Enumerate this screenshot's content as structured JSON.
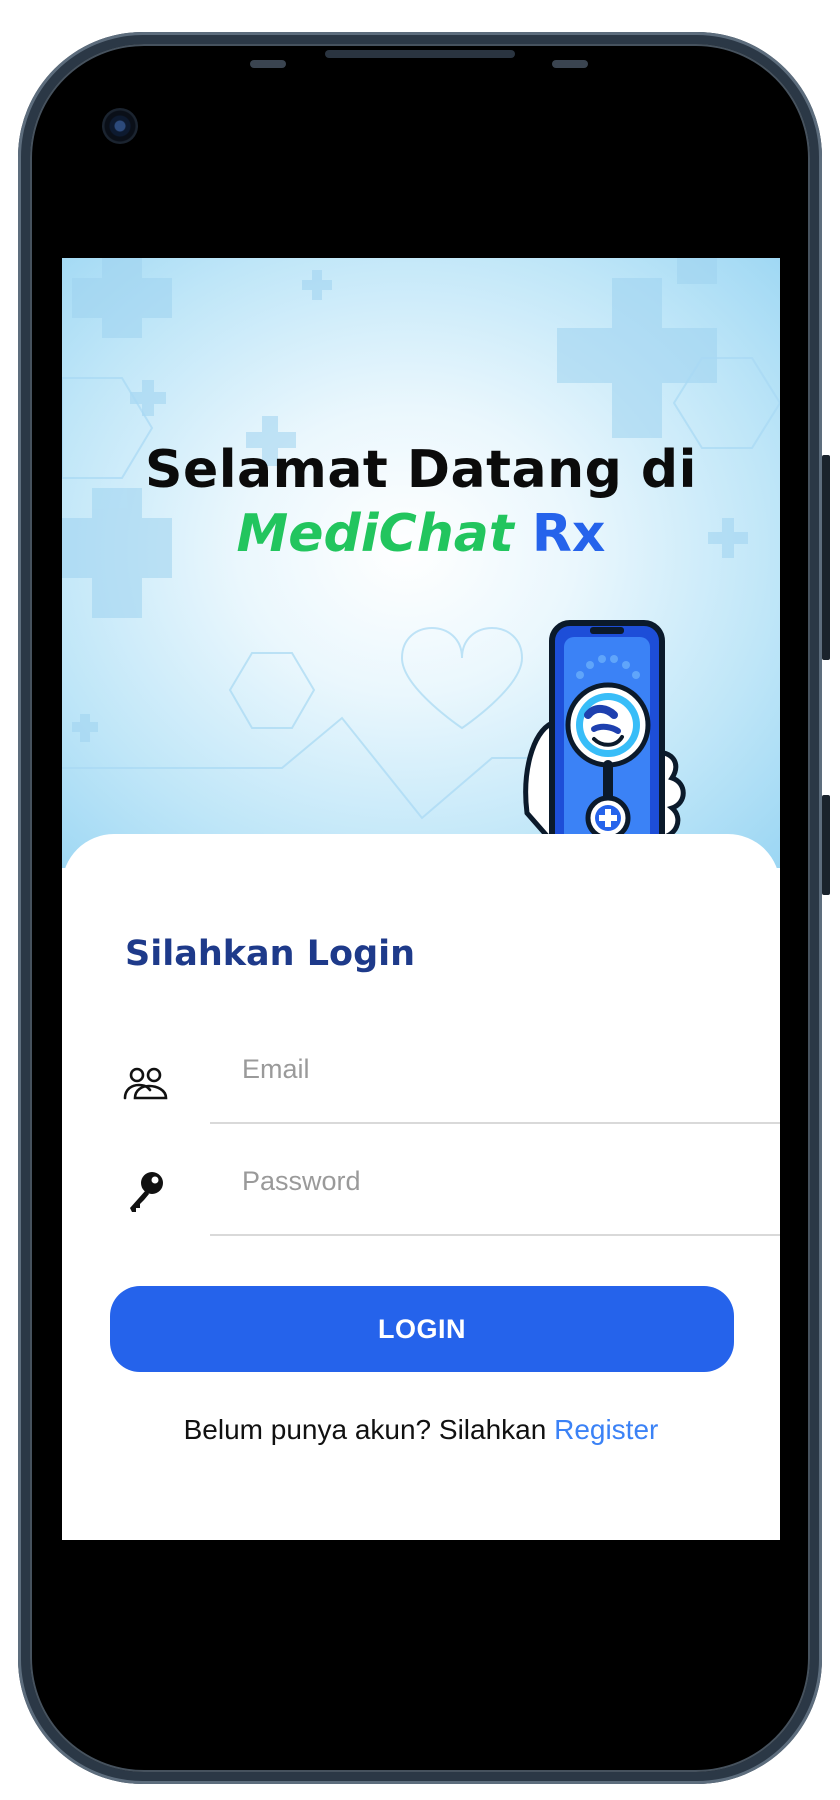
{
  "welcome": {
    "line1": "Selamat Datang di",
    "brand_green": "MediChat",
    "brand_blue": "Rx"
  },
  "login": {
    "title": "Silahkan Login",
    "email_placeholder": "Email",
    "password_placeholder": "Password",
    "button_label": "LOGIN"
  },
  "register": {
    "prompt": "Belum punya akun? Silahkan ",
    "link_label": "Register"
  },
  "icons": {
    "email_icon": "users-icon",
    "password_icon": "key-icon",
    "mascot": "phone-stethoscope-icon"
  },
  "colors": {
    "primary_blue": "#2563eb",
    "brand_green": "#22c55e",
    "title_navy": "#1e3a8a",
    "link_blue": "#3b82f6"
  }
}
